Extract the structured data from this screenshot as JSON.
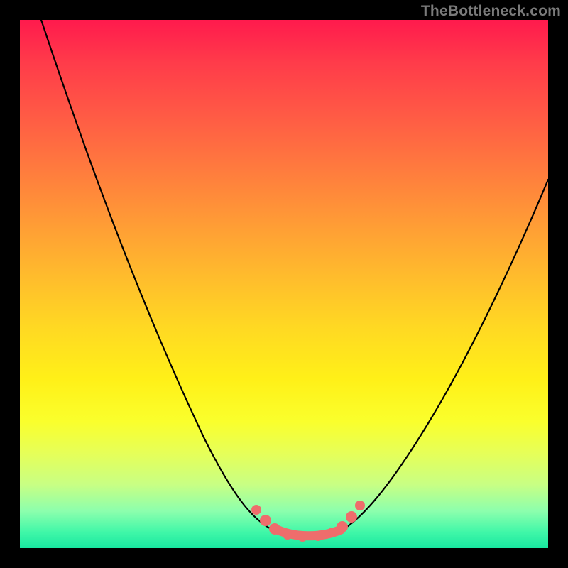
{
  "watermark": "TheBottleneck.com",
  "chart_data": {
    "type": "line",
    "title": "",
    "xlabel": "",
    "ylabel": "",
    "xlim": [
      0,
      100
    ],
    "ylim": [
      0,
      100
    ],
    "series": [
      {
        "name": "bottleneck-curve",
        "x": [
          4,
          10,
          16,
          22,
          28,
          34,
          40,
          44,
          47,
          50,
          53,
          56,
          59,
          62,
          68,
          76,
          84,
          92,
          100
        ],
        "y": [
          100,
          84,
          69,
          55,
          42,
          30,
          19,
          11,
          6,
          3,
          2,
          3,
          6,
          11,
          22,
          37,
          52,
          65,
          77
        ]
      }
    ],
    "highlight_segment": {
      "name": "valley-floor",
      "x_range": [
        46,
        61
      ],
      "markers_x": [
        44,
        46,
        49,
        58,
        59,
        60,
        61
      ]
    },
    "background_gradient": {
      "top": "#ff1a4d",
      "mid": "#ffe31e",
      "bottom": "#18e7a0"
    }
  }
}
